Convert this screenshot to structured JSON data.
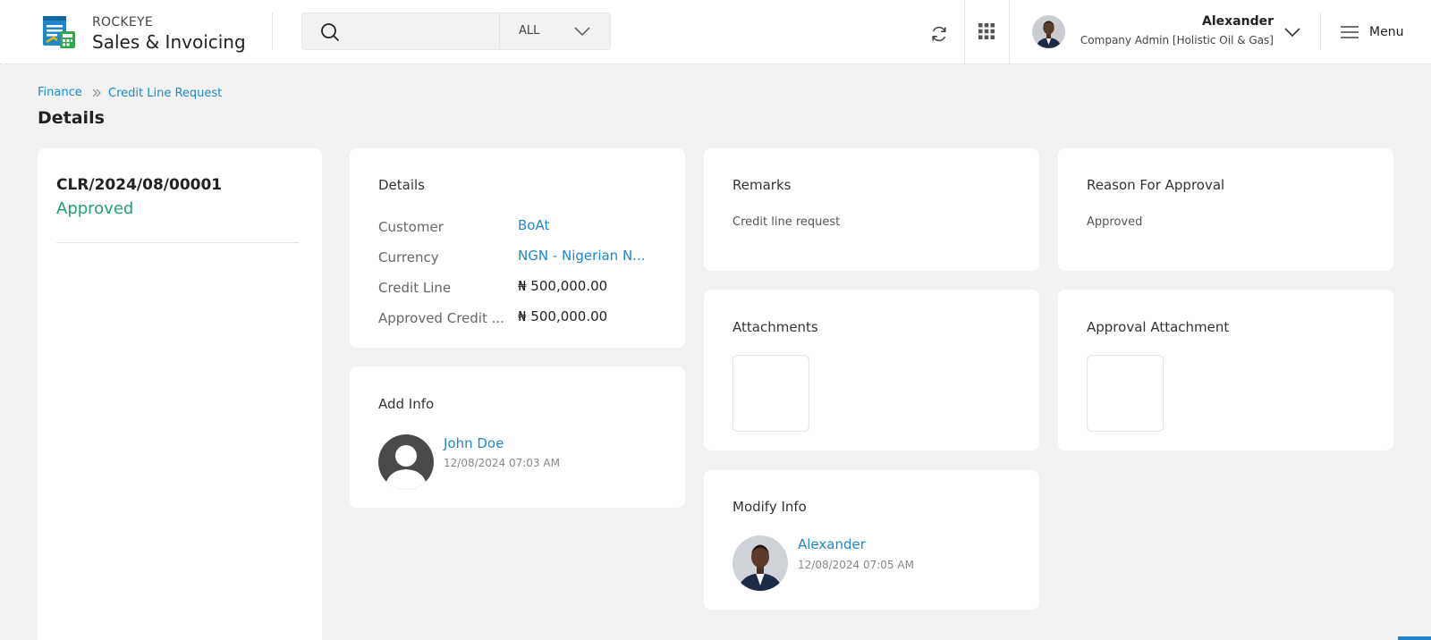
{
  "header": {
    "brand_top": "ROCKEYE",
    "brand_main": "Sales & Invoicing",
    "search_placeholder": "",
    "search_scope": "ALL",
    "user_name": "Alexander",
    "user_role": "Company Admin [Holistic Oil & Gas]",
    "menu_label": "Menu"
  },
  "breadcrumb": {
    "items": [
      "Finance",
      "Credit Line Request"
    ]
  },
  "page_title": "Details",
  "summary": {
    "doc_number": "CLR/2024/08/00001",
    "status": "Approved",
    "status_color": "#22a06b"
  },
  "details": {
    "title": "Details",
    "rows": [
      {
        "label": "Customer",
        "value": "BoAt"
      },
      {
        "label": "Currency",
        "value": "NGN - Nigerian N..."
      },
      {
        "label": "Credit Line",
        "value": "₦ 500,000.00"
      },
      {
        "label": "Approved Credit ...",
        "value": "₦ 500,000.00"
      }
    ]
  },
  "add_info": {
    "title": "Add Info",
    "name": "John Doe",
    "timestamp": "12/08/2024 07:03 AM"
  },
  "remarks": {
    "title": "Remarks",
    "text": "Credit line request"
  },
  "attachments": {
    "title": "Attachments"
  },
  "modify_info": {
    "title": "Modify Info",
    "name": "Alexander",
    "timestamp": "12/08/2024 07:05 AM"
  },
  "reason": {
    "title": "Reason For Approval",
    "text": "Approved"
  },
  "approval_attachment": {
    "title": "Approval Attachment"
  },
  "colors": {
    "link": "#1e88c8",
    "approved": "#22a06b",
    "background": "#f2f2f2"
  }
}
